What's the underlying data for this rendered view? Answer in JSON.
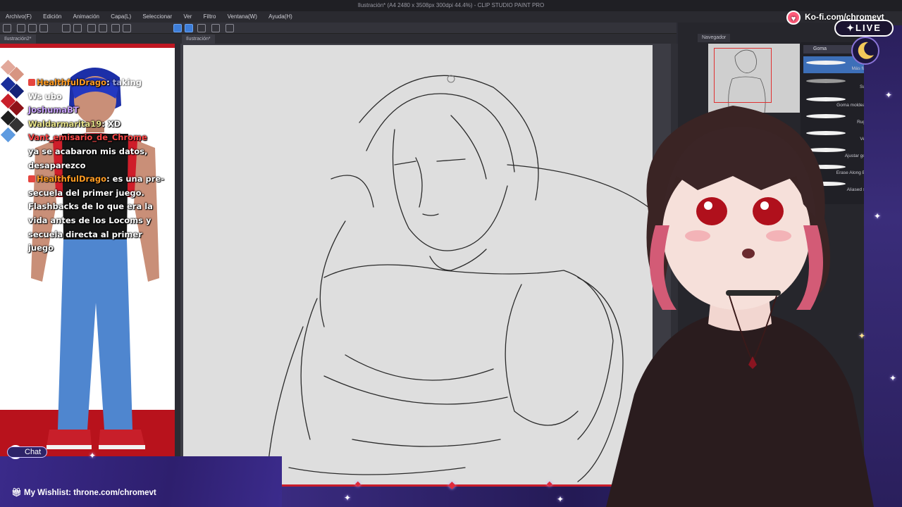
{
  "window": {
    "title": "Ilustración* (A4 2480 x 3508px 300dpi 44.4%) - CLIP STUDIO PAINT PRO"
  },
  "menu": [
    "Archivo(F)",
    "Edición",
    "Animación",
    "Capa(L)",
    "Seleccionar",
    "Ver",
    "Filtro",
    "Ventana(W)",
    "Ayuda(H)"
  ],
  "tabs": {
    "left_doc": "Ilustración2*",
    "main_doc": "Ilustración*"
  },
  "panels": {
    "navigator_tab": "Navegador",
    "brush_category": "Goma",
    "brushes": [
      "Más fu",
      "Su",
      "Goma moldea",
      "Rug",
      "Ve",
      "Ajustar go",
      "Erase Along E",
      "Aliased s"
    ]
  },
  "chat": {
    "messages": [
      {
        "user": "HealthfulDrago",
        "user_color": "#ff9b22",
        "badge": true,
        "text": "taking",
        "faded": false
      },
      {
        "user": "",
        "user_color": "",
        "badge": false,
        "text": "Ws ubo",
        "faded": true
      },
      {
        "user": "JoshumaBT",
        "user_color": "#c9a2ff",
        "badge": false,
        "text": "",
        "faded": false
      },
      {
        "user": "Waldarmarita19",
        "user_color": "#e7e38a",
        "badge": false,
        "text": "XD",
        "faded": false
      },
      {
        "user": "Vant_emisario_de_Chrome",
        "user_color": "#ff4848",
        "badge": false,
        "text": "ya se acabaron mis datos, desaparezco",
        "faded": false
      },
      {
        "user": "HealthfulDrago",
        "user_color": "#ff9b22",
        "badge": true,
        "text": "es una pre-secuela del primer juego. Flashbacks de lo que era la vida antes de los Locoms y secuela directa al primer juego",
        "faded": false
      }
    ]
  },
  "overlay": {
    "kofi": "Ko-fi.com/chromevt",
    "live": "LIVE",
    "chat_label": "Chat",
    "wishlist": "My Wishlist: throne.com/chromevt"
  },
  "colors": {
    "accent_red": "#c01722",
    "overlay_purple": "#2e1f6e",
    "live_bg": "#1b1430"
  },
  "icons": [
    "kofi-cup-icon",
    "live-sparkle-icon",
    "moon-icon",
    "chat-bubble-icon",
    "gift-icon",
    "star-icon"
  ]
}
